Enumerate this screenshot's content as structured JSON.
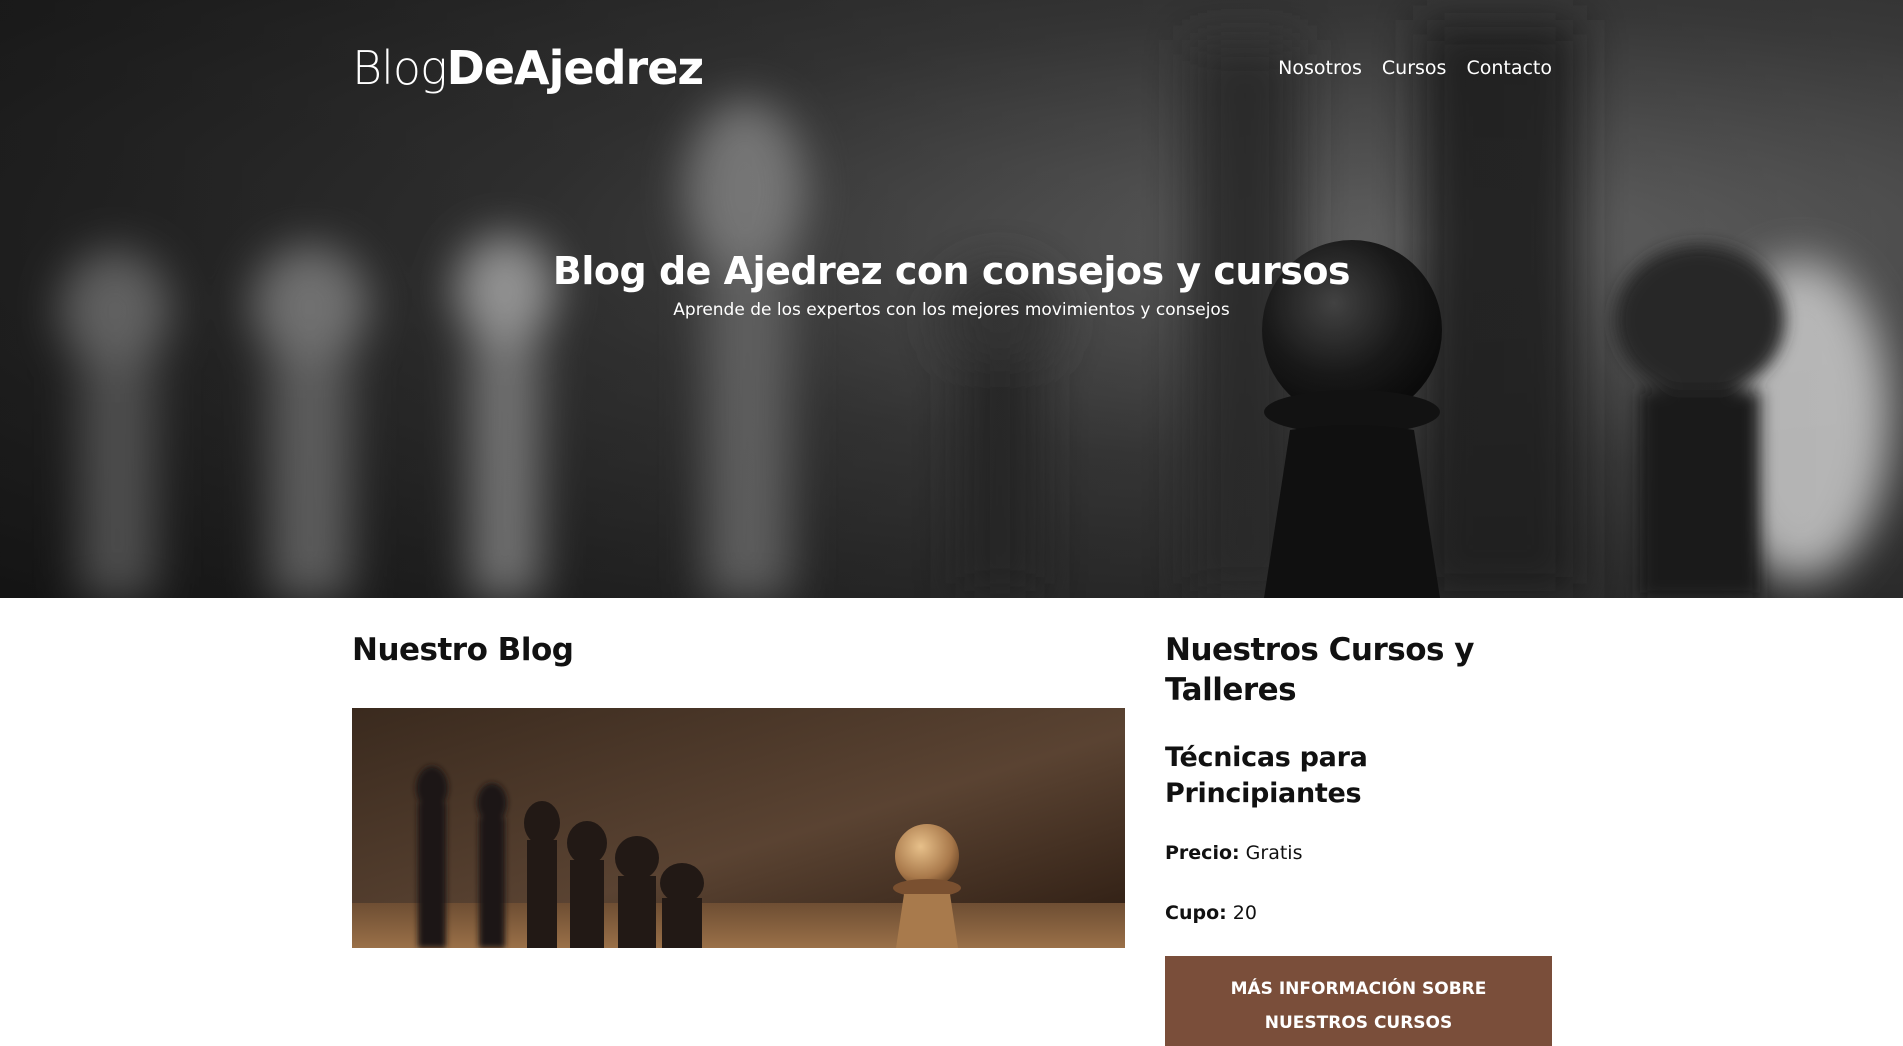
{
  "header": {
    "logo_light": "Blog",
    "logo_bold": "DeAjedrez",
    "nav": [
      {
        "label": "Nosotros"
      },
      {
        "label": "Cursos"
      },
      {
        "label": "Contacto"
      }
    ]
  },
  "hero": {
    "title": "Blog de Ajedrez con consejos y cursos",
    "subtitle": "Aprende de los expertos con los mejores movimientos y consejos"
  },
  "blog": {
    "title": "Nuestro Blog"
  },
  "courses": {
    "title": "Nuestros Cursos y Talleres",
    "course_name": "Técnicas para Principiantes",
    "price_label": "Precio:",
    "price_value": "Gratis",
    "seats_label": "Cupo:",
    "seats_value": "20",
    "button_label": "Más información sobre nuestros cursos"
  },
  "colors": {
    "button": "#7a4e3a",
    "hero_text": "#ffffff",
    "body_text": "#111111"
  }
}
